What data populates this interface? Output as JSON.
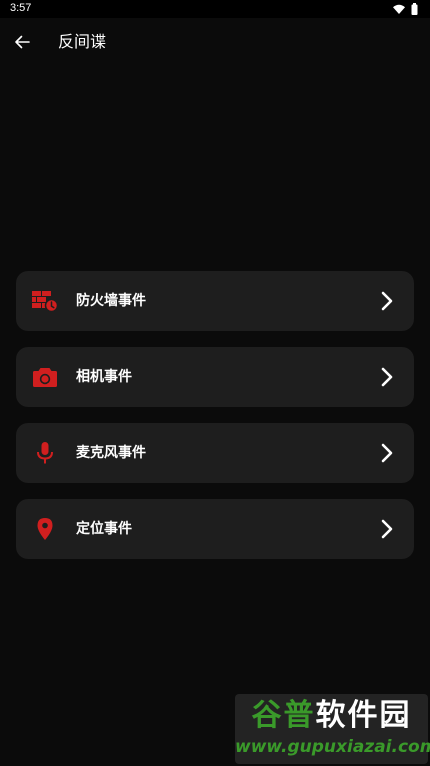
{
  "status_bar": {
    "time": "3:57",
    "icons": [
      "wifi-icon",
      "battery-icon"
    ]
  },
  "app_bar": {
    "back_icon": "arrow-left-icon",
    "title": "反间谍"
  },
  "menu": {
    "items": [
      {
        "label": "防火墙事件",
        "icon": "firewall-icon"
      },
      {
        "label": "相机事件",
        "icon": "camera-icon"
      },
      {
        "label": "麦克风事件",
        "icon": "microphone-icon"
      },
      {
        "label": "定位事件",
        "icon": "location-pin-icon"
      }
    ],
    "chevron_icon": "chevron-right-icon"
  },
  "watermark": {
    "line1_part1": "谷普",
    "line1_part2": "软件园",
    "line2": "www.gupuxiazai.com"
  },
  "colors": {
    "background": "#0b0b0b",
    "card": "#1e1e1e",
    "accent_red": "#d01f1f",
    "text": "#ffffff",
    "watermark_green": "#3a9a2a"
  }
}
